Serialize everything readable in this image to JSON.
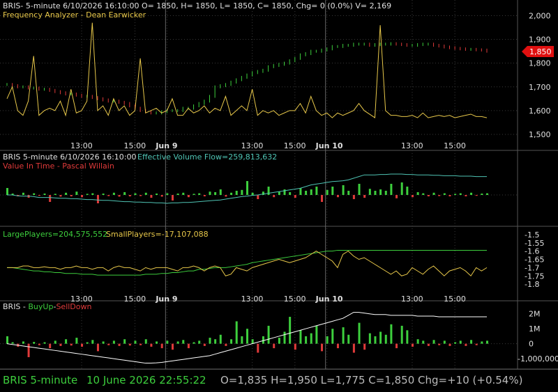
{
  "colors": {
    "background": "#000000",
    "grid": "#3a3a3a",
    "text": "#e0e0e0",
    "yellow": "#e8c84a",
    "cyan": "#4fc4b4",
    "red": "#e03a3a",
    "green": "#3dcf3d",
    "white": "#ffffff",
    "price_flag": "#e01010"
  },
  "panel1": {
    "header": "BRIS- 5-minute 6/10/2026 16:10:00 O= 1850, H= 1850, L= 1850, C= 1850, Chg= 0 (0.0%) V= 2,169",
    "subtitle": "Frequency Analyzer - Dean Earwicker",
    "price_flag": "1,850"
  },
  "panel2": {
    "header": "BRIS 5-minute  6/10/2026 16:10:00",
    "flow_label": "Effective Volume Flow=259,813,632",
    "subtitle": "Value In Time - Pascal Willain"
  },
  "panel3": {
    "large_label": "LargePlayers=204,575,552",
    "small_label": "SmallPlayers=-17,107,088"
  },
  "panel4": {
    "title": "BRIS",
    "sep1": " - ",
    "buy_label": "BuyUp",
    "sep2": "-",
    "sell_label": "SellDown"
  },
  "status": {
    "symbol": "BRIS  5-minute",
    "datetime": "10 June 2026 22:55:22",
    "ohlc": "O=1,835  H=1,950  L=1,775  C=1,850  Chg=+10 (+0.54%)"
  },
  "chart_data": [
    {
      "type": "candlestick",
      "name": "price",
      "ylim": [
        1450,
        2060
      ],
      "yticks": [
        "2,000",
        "1,900",
        "1,800",
        "1,700",
        "1,600",
        "1,500"
      ],
      "ytick_values": [
        2000,
        1900,
        1800,
        1700,
        1600,
        1500
      ],
      "x_labels": [
        "13:00",
        "15:00",
        "Jun 9",
        "13:00",
        "15:00",
        "Jun 10",
        "13:00",
        "15:00"
      ],
      "x_label_index": [
        14,
        24,
        30,
        46,
        54,
        60,
        76,
        84
      ],
      "day_separator_index": [
        30,
        60
      ],
      "closes": [
        1710,
        1705,
        1700,
        1700,
        1695,
        1695,
        1690,
        1690,
        1685,
        1680,
        1675,
        1670,
        1670,
        1665,
        1660,
        1660,
        1655,
        1650,
        1645,
        1640,
        1640,
        1635,
        1630,
        1620,
        1610,
        1600,
        1595,
        1590,
        1590,
        1595,
        1600,
        1600,
        1600,
        1610,
        1610,
        1620,
        1630,
        1640,
        1660,
        1700,
        1705,
        1710,
        1720,
        1730,
        1740,
        1750,
        1760,
        1765,
        1770,
        1785,
        1790,
        1795,
        1800,
        1810,
        1820,
        1835,
        1840,
        1850,
        1850,
        1855,
        1860,
        1870,
        1870,
        1875,
        1875,
        1880,
        1880,
        1880,
        1875,
        1878,
        1880,
        1880,
        1882,
        1880,
        1878,
        1875,
        1875,
        1878,
        1880,
        1880,
        1875,
        1872,
        1868,
        1865,
        1862,
        1860,
        1858,
        1858,
        1856,
        1855,
        1850
      ]
    },
    {
      "type": "line",
      "name": "Frequency Analyzer - Dean Earwicker",
      "values": [
        1650,
        1700,
        1600,
        1580,
        1640,
        1830,
        1580,
        1600,
        1610,
        1600,
        1640,
        1580,
        1690,
        1590,
        1600,
        1640,
        1970,
        1600,
        1620,
        1580,
        1650,
        1600,
        1620,
        1580,
        1600,
        1820,
        1590,
        1600,
        1610,
        1590,
        1600,
        1650,
        1580,
        1580,
        1610,
        1590,
        1600,
        1620,
        1590,
        1610,
        1600,
        1660,
        1580,
        1600,
        1620,
        1600,
        1690,
        1580,
        1600,
        1590,
        1600,
        1580,
        1590,
        1600,
        1600,
        1630,
        1590,
        1660,
        1600,
        1580,
        1590,
        1570,
        1590,
        1580,
        1590,
        1600,
        1630,
        1600,
        1585,
        1570,
        1960,
        1600,
        1580,
        1580,
        1575,
        1575,
        1580,
        1570,
        1590,
        1570,
        1575,
        1580,
        1575,
        1580,
        1570,
        1575,
        1580,
        1585,
        1575,
        1575,
        1570
      ]
    },
    {
      "type": "bar+line",
      "name": "Effective Volume Flow",
      "ylim": [
        -1,
        1
      ],
      "flow_line": [
        0.0,
        0.0,
        -0.02,
        -0.03,
        -0.03,
        -0.04,
        -0.06,
        -0.06,
        -0.06,
        -0.07,
        -0.08,
        -0.08,
        -0.09,
        -0.09,
        -0.1,
        -0.11,
        -0.11,
        -0.12,
        -0.13,
        -0.13,
        -0.14,
        -0.15,
        -0.16,
        -0.16,
        -0.17,
        -0.17,
        -0.18,
        -0.18,
        -0.19,
        -0.19,
        -0.2,
        -0.19,
        -0.19,
        -0.18,
        -0.18,
        -0.17,
        -0.16,
        -0.15,
        -0.14,
        -0.13,
        -0.12,
        -0.1,
        -0.08,
        -0.06,
        -0.04,
        -0.03,
        -0.01,
        0.0,
        0.02,
        0.04,
        0.06,
        0.08,
        0.1,
        0.12,
        0.14,
        0.16,
        0.2,
        0.24,
        0.26,
        0.28,
        0.3,
        0.32,
        0.33,
        0.34,
        0.36,
        0.4,
        0.44,
        0.48,
        0.48,
        0.48,
        0.49,
        0.49,
        0.5,
        0.5,
        0.5,
        0.49,
        0.49,
        0.48,
        0.48,
        0.48,
        0.47,
        0.47,
        0.46,
        0.46,
        0.46,
        0.45,
        0.45,
        0.45,
        0.44,
        0.44,
        0.44
      ],
      "bars": [
        0.25,
        0.05,
        -0.05,
        0.08,
        -0.1,
        0.06,
        -0.03,
        0.05,
        -0.25,
        0.04,
        -0.06,
        0.08,
        -0.05,
        0.12,
        -0.08,
        0.04,
        0.06,
        -0.3,
        0.05,
        -0.04,
        0.08,
        -0.06,
        0.1,
        -0.05,
        0.06,
        -0.04,
        0.08,
        -0.1,
        0.05,
        -0.06,
        0.06,
        -0.2,
        0.05,
        0.08,
        -0.08,
        0.04,
        0.06,
        -0.05,
        0.12,
        0.1,
        0.2,
        -0.06,
        0.08,
        0.15,
        0.18,
        0.5,
        0.08,
        -0.15,
        0.12,
        0.3,
        -0.08,
        0.12,
        0.2,
        0.1,
        -0.1,
        0.25,
        0.15,
        0.2,
        0.3,
        -0.25,
        0.18,
        0.3,
        -0.08,
        0.35,
        0.15,
        -0.15,
        0.4,
        -0.1,
        0.22,
        0.15,
        0.2,
        0.15,
        0.4,
        -0.12,
        0.45,
        0.3,
        -0.08,
        0.1,
        0.06,
        -0.05,
        0.08,
        -0.04,
        0.06,
        -0.05,
        0.04,
        0.06,
        -0.05,
        0.08,
        -0.03,
        0.05,
        0.06
      ]
    },
    {
      "type": "line",
      "name": "LargePlayers / SmallPlayers",
      "ylim": [
        -1.85,
        -1.45
      ],
      "yticks": [
        "-1.5",
        "-1.55",
        "-1.6",
        "-1.65",
        "-1.7",
        "-1.75",
        "-1.8"
      ],
      "ytick_values": [
        -1.5,
        -1.55,
        -1.6,
        -1.65,
        -1.7,
        -1.75,
        -1.8
      ],
      "large": [
        -1.7,
        -1.7,
        -1.705,
        -1.71,
        -1.715,
        -1.72,
        -1.72,
        -1.725,
        -1.725,
        -1.73,
        -1.73,
        -1.735,
        -1.735,
        -1.735,
        -1.74,
        -1.74,
        -1.74,
        -1.745,
        -1.745,
        -1.745,
        -1.745,
        -1.745,
        -1.745,
        -1.745,
        -1.745,
        -1.745,
        -1.74,
        -1.74,
        -1.74,
        -1.735,
        -1.735,
        -1.73,
        -1.73,
        -1.725,
        -1.72,
        -1.72,
        -1.71,
        -1.71,
        -1.705,
        -1.7,
        -1.7,
        -1.7,
        -1.695,
        -1.69,
        -1.685,
        -1.68,
        -1.67,
        -1.665,
        -1.66,
        -1.655,
        -1.65,
        -1.645,
        -1.64,
        -1.635,
        -1.63,
        -1.625,
        -1.62,
        -1.615,
        -1.61,
        -1.605,
        -1.6,
        -1.6,
        -1.595,
        -1.595,
        -1.595,
        -1.595,
        -1.595,
        -1.595,
        -1.595,
        -1.595,
        -1.595,
        -1.595,
        -1.595,
        -1.595,
        -1.595,
        -1.595,
        -1.595,
        -1.595,
        -1.595,
        -1.595,
        -1.595,
        -1.595,
        -1.595,
        -1.595,
        -1.595,
        -1.595,
        -1.595,
        -1.595,
        -1.595,
        -1.595,
        -1.595
      ],
      "small": [
        -1.7,
        -1.7,
        -1.7,
        -1.69,
        -1.69,
        -1.7,
        -1.7,
        -1.695,
        -1.7,
        -1.7,
        -1.71,
        -1.7,
        -1.7,
        -1.69,
        -1.7,
        -1.7,
        -1.71,
        -1.7,
        -1.7,
        -1.72,
        -1.7,
        -1.69,
        -1.7,
        -1.7,
        -1.71,
        -1.72,
        -1.7,
        -1.71,
        -1.7,
        -1.7,
        -1.7,
        -1.71,
        -1.72,
        -1.7,
        -1.7,
        -1.69,
        -1.7,
        -1.72,
        -1.7,
        -1.69,
        -1.7,
        -1.75,
        -1.74,
        -1.7,
        -1.71,
        -1.72,
        -1.7,
        -1.69,
        -1.68,
        -1.67,
        -1.66,
        -1.65,
        -1.66,
        -1.67,
        -1.66,
        -1.65,
        -1.64,
        -1.62,
        -1.6,
        -1.62,
        -1.64,
        -1.66,
        -1.7,
        -1.62,
        -1.6,
        -1.63,
        -1.65,
        -1.64,
        -1.66,
        -1.68,
        -1.7,
        -1.72,
        -1.74,
        -1.72,
        -1.75,
        -1.74,
        -1.7,
        -1.72,
        -1.74,
        -1.71,
        -1.69,
        -1.72,
        -1.75,
        -1.72,
        -1.71,
        -1.7,
        -1.72,
        -1.75,
        -1.7,
        -1.72,
        -1.7
      ]
    },
    {
      "type": "bar+line",
      "name": "BuyUp-SellDown",
      "ylim": [
        -1600000,
        2500000
      ],
      "yticks": [
        "2M",
        "1M",
        "0",
        "-1,000,000"
      ],
      "ytick_values": [
        2000000,
        1000000,
        0,
        -1000000
      ],
      "line": [
        0,
        -50000,
        -100000,
        -150000,
        -200000,
        -250000,
        -300000,
        -350000,
        -400000,
        -450000,
        -500000,
        -550000,
        -600000,
        -650000,
        -700000,
        -750000,
        -800000,
        -850000,
        -900000,
        -950000,
        -1000000,
        -1050000,
        -1100000,
        -1150000,
        -1200000,
        -1250000,
        -1300000,
        -1300000,
        -1280000,
        -1250000,
        -1200000,
        -1150000,
        -1100000,
        -1050000,
        -1000000,
        -950000,
        -900000,
        -850000,
        -800000,
        -700000,
        -600000,
        -500000,
        -400000,
        -300000,
        -200000,
        -100000,
        0,
        100000,
        200000,
        300000,
        400000,
        500000,
        600000,
        700000,
        800000,
        900000,
        1000000,
        1100000,
        1200000,
        1300000,
        1400000,
        1500000,
        1600000,
        1700000,
        1900000,
        2100000,
        2100000,
        2050000,
        2000000,
        1950000,
        1950000,
        1950000,
        1900000,
        1900000,
        1900000,
        1900000,
        1900000,
        1850000,
        1850000,
        1850000,
        1850000,
        1800000,
        1800000,
        1800000,
        1800000,
        1800000,
        1800000,
        1800000,
        1800000,
        1800000,
        1800000
      ],
      "bars": [
        500000,
        100000,
        -200000,
        150000,
        -900000,
        120000,
        -100000,
        100000,
        -300000,
        200000,
        -150000,
        300000,
        -120000,
        400000,
        -200000,
        100000,
        250000,
        -500000,
        150000,
        -100000,
        200000,
        -150000,
        300000,
        -120000,
        200000,
        -100000,
        300000,
        -200000,
        150000,
        -300000,
        200000,
        -400000,
        150000,
        250000,
        -300000,
        100000,
        200000,
        -150000,
        400000,
        300000,
        600000,
        -150000,
        300000,
        1500000,
        500000,
        1000000,
        300000,
        -600000,
        500000,
        1200000,
        -300000,
        400000,
        800000,
        1800000,
        -400000,
        900000,
        500000,
        700000,
        1200000,
        -500000,
        500000,
        1000000,
        -300000,
        1100000,
        600000,
        -600000,
        1400000,
        -400000,
        700000,
        500000,
        800000,
        600000,
        1300000,
        -300000,
        1200000,
        900000,
        -200000,
        300000,
        200000,
        -150000,
        250000,
        -100000,
        200000,
        -150000,
        100000,
        200000,
        -150000,
        250000,
        -100000,
        150000,
        200000
      ]
    }
  ]
}
